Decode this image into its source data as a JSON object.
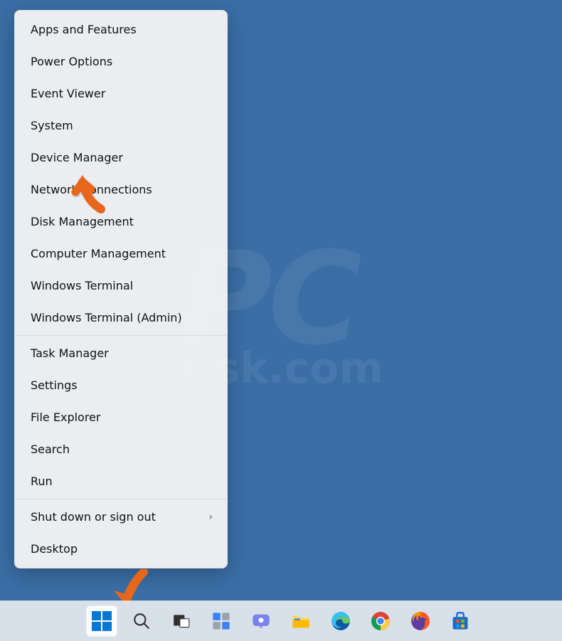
{
  "watermark": {
    "line1": "PC",
    "line2": "risk.com"
  },
  "menu": {
    "groups": [
      [
        "Apps and Features",
        "Power Options",
        "Event Viewer",
        "System",
        "Device Manager",
        "Network Connections",
        "Disk Management",
        "Computer Management",
        "Windows Terminal",
        "Windows Terminal (Admin)"
      ],
      [
        "Task Manager",
        "Settings",
        "File Explorer",
        "Search",
        "Run"
      ],
      [
        {
          "label": "Shut down or sign out",
          "submenu": true
        },
        "Desktop"
      ]
    ]
  },
  "taskbar": {
    "start": "Start",
    "search": "Search",
    "taskview": "Task View",
    "widgets": "Widgets",
    "chat": "Chat",
    "explorer": "File Explorer",
    "edge": "Microsoft Edge",
    "chrome": "Google Chrome",
    "firefox": "Firefox",
    "store": "Microsoft Store"
  },
  "annotations": {
    "arrow_color": "#e8661b",
    "arrow1_target": "Device Manager",
    "arrow2_target": "Start"
  }
}
